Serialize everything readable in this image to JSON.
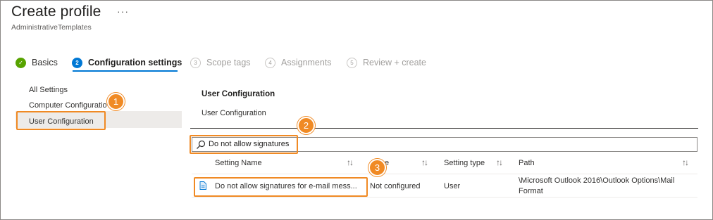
{
  "header": {
    "title": "Create profile",
    "more_label": "···",
    "subtitle": "AdministrativeTemplates"
  },
  "wizard": {
    "steps": [
      {
        "number": "✓",
        "label": "Basics",
        "state": "done"
      },
      {
        "number": "2",
        "label": "Configuration settings",
        "state": "active"
      },
      {
        "number": "3",
        "label": "Scope tags",
        "state": "pending"
      },
      {
        "number": "4",
        "label": "Assignments",
        "state": "pending"
      },
      {
        "number": "5",
        "label": "Review + create",
        "state": "pending"
      }
    ]
  },
  "nav": {
    "items": [
      {
        "label": "All Settings",
        "selected": false
      },
      {
        "label": "Computer Configuratio",
        "selected": false
      },
      {
        "label": "User Configuration",
        "selected": true
      }
    ]
  },
  "callouts": [
    "1",
    "2",
    "3"
  ],
  "main": {
    "section_title": "User Configuration",
    "section_subtitle": "User Configuration",
    "search": {
      "icon": "search-icon",
      "value": "Do not allow signatures"
    },
    "table": {
      "columns": [
        "Setting Name",
        "e",
        "Setting type",
        "Path"
      ],
      "sort_glyph": "↑↓",
      "rows": [
        {
          "icon": "document-icon",
          "name": "Do not allow signatures for e-mail mess...",
          "state": "Not configured",
          "type": "User",
          "path_line1": "\\Microsoft Outlook 2016\\Outlook Options\\Mail",
          "path_line2": "Format"
        }
      ]
    }
  },
  "colors": {
    "accent": "#0078d4",
    "success": "#57a300",
    "callout": "#f08a24"
  }
}
